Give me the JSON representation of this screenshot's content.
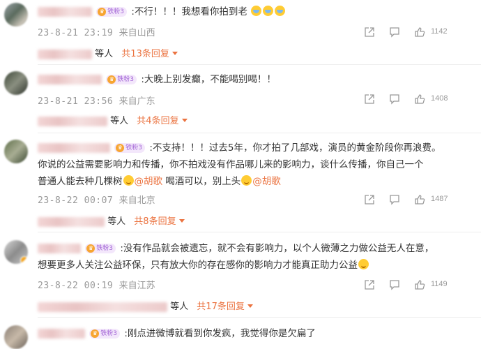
{
  "badge_label": "铁粉3",
  "comments": [
    {
      "text_main": ":不行！！！我想看你拍到老",
      "time": "23-8-21 23:19",
      "location": "来自山西",
      "likes": "1142",
      "replies_suffix": "等人",
      "replies_more": "共13条回复"
    },
    {
      "text_main": ":大晚上别发癫，不能喝别喝！！",
      "time": "23-8-21 23:56",
      "location": "来自广东",
      "likes": "1408",
      "replies_suffix": "等人",
      "replies_more": "共4条回复"
    },
    {
      "line1": ":不支持！！！过去5年，你才拍了几部戏，演员的黄金阶段你再浪费。",
      "line2": "你说的公益需要影响力和传播，你不拍戏没有作品哪儿来的影响力，谈什么传播，你自己一个",
      "line3_a": "普通人能去种几棵树",
      "mention1": "@胡歌",
      "line3_b": " 喝酒可以，别上头",
      "mention2": "@胡歌",
      "time": "23-8-22 00:07",
      "location": "来自北京",
      "likes": "1487",
      "replies_suffix": "等人",
      "replies_more": "共8条回复"
    },
    {
      "line1": ":没有作品就会被遗忘，就不会有影响力，以个人微薄之力做公益无人在意，",
      "line2": "想要更多人关注公益环保，只有放大你的存在感你的影响力才能真正助力公益",
      "time": "23-8-22 00:19",
      "location": "来自江苏",
      "likes": "1149",
      "replies_suffix": "等人",
      "replies_more": "共17条回复"
    },
    {
      "text_main": ":刚点进微博就看到你发疯，我觉得你是欠扁了"
    }
  ]
}
